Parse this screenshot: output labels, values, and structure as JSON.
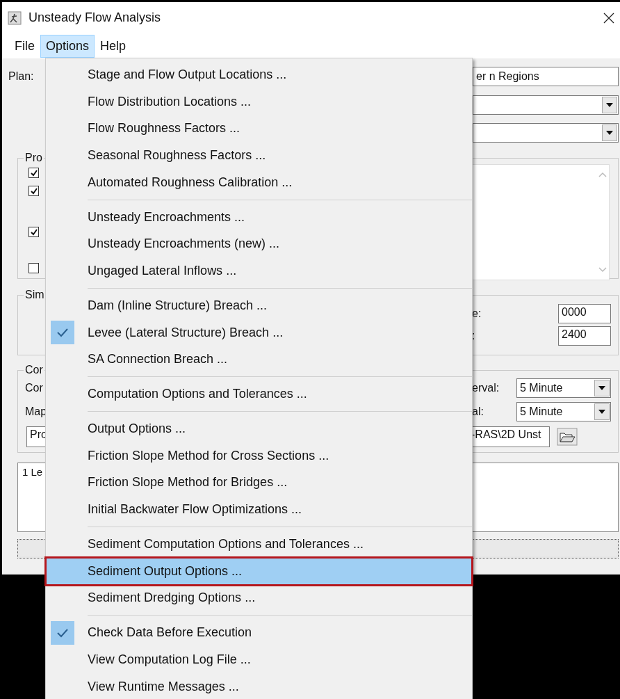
{
  "window": {
    "title": "Unsteady Flow Analysis"
  },
  "menu_bar": [
    {
      "label": "File",
      "selected": false
    },
    {
      "label": "Options",
      "selected": true
    },
    {
      "label": "Help",
      "selected": false
    }
  ],
  "plan": {
    "label": "Plan:",
    "value": "er n Regions"
  },
  "programs_group": {
    "label": "Pro",
    "checkboxes": [
      {
        "checked": true
      },
      {
        "checked": true
      },
      {
        "checked": true
      },
      {
        "checked": false
      }
    ]
  },
  "simulation_group": {
    "label": "Sim",
    "fields": [
      {
        "label": "e:",
        "value": "0000"
      },
      {
        "label": ":",
        "value": "2400"
      }
    ]
  },
  "computation_group": {
    "label": "Cor",
    "rows": [
      {
        "label": "Cor",
        "interval_label": "erval:",
        "value": "5 Minute"
      },
      {
        "label": "Map",
        "interval_label": "al:",
        "value": "5 Minute"
      }
    ],
    "path_left": "Pro",
    "path_right": "-RAS\\2D Unst"
  },
  "log": {
    "text": "1 Le"
  },
  "options_menu": [
    [
      {
        "label": "Stage and Flow Output Locations ...",
        "checked": false,
        "selected": false,
        "outlined": false
      },
      {
        "label": "Flow Distribution Locations ...",
        "checked": false,
        "selected": false,
        "outlined": false
      },
      {
        "label": "Flow Roughness Factors ...",
        "checked": false,
        "selected": false,
        "outlined": false
      },
      {
        "label": "Seasonal Roughness Factors ...",
        "checked": false,
        "selected": false,
        "outlined": false
      },
      {
        "label": "Automated Roughness Calibration ...",
        "checked": false,
        "selected": false,
        "outlined": false
      }
    ],
    [
      {
        "label": "Unsteady Encroachments ...",
        "checked": false,
        "selected": false,
        "outlined": false
      },
      {
        "label": "Unsteady Encroachments (new) ...",
        "checked": false,
        "selected": false,
        "outlined": false
      },
      {
        "label": "Ungaged Lateral Inflows ...",
        "checked": false,
        "selected": false,
        "outlined": false
      }
    ],
    [
      {
        "label": "Dam (Inline Structure) Breach ...",
        "checked": false,
        "selected": false,
        "outlined": false
      },
      {
        "label": "Levee (Lateral Structure) Breach ...",
        "checked": true,
        "selected": false,
        "outlined": false
      },
      {
        "label": "SA Connection Breach ...",
        "checked": false,
        "selected": false,
        "outlined": false
      }
    ],
    [
      {
        "label": "Computation Options and Tolerances ...",
        "checked": false,
        "selected": false,
        "outlined": false
      }
    ],
    [
      {
        "label": "Output Options ...",
        "checked": false,
        "selected": false,
        "outlined": false
      },
      {
        "label": "Friction Slope Method for Cross Sections ...",
        "checked": false,
        "selected": false,
        "outlined": false
      },
      {
        "label": "Friction Slope Method for Bridges ...",
        "checked": false,
        "selected": false,
        "outlined": false
      },
      {
        "label": "Initial Backwater Flow Optimizations ...",
        "checked": false,
        "selected": false,
        "outlined": false
      }
    ],
    [
      {
        "label": "Sediment Computation Options and Tolerances ...",
        "checked": false,
        "selected": false,
        "outlined": false
      },
      {
        "label": "Sediment Output Options ...",
        "checked": false,
        "selected": true,
        "outlined": true
      },
      {
        "label": "Sediment Dredging Options ...",
        "checked": false,
        "selected": false,
        "outlined": false
      }
    ],
    [
      {
        "label": "Check Data Before Execution",
        "checked": true,
        "selected": false,
        "outlined": false
      },
      {
        "label": "View Computation Log File ...",
        "checked": false,
        "selected": false,
        "outlined": false
      },
      {
        "label": "View Runtime Messages ...",
        "checked": false,
        "selected": false,
        "outlined": false
      }
    ]
  ]
}
